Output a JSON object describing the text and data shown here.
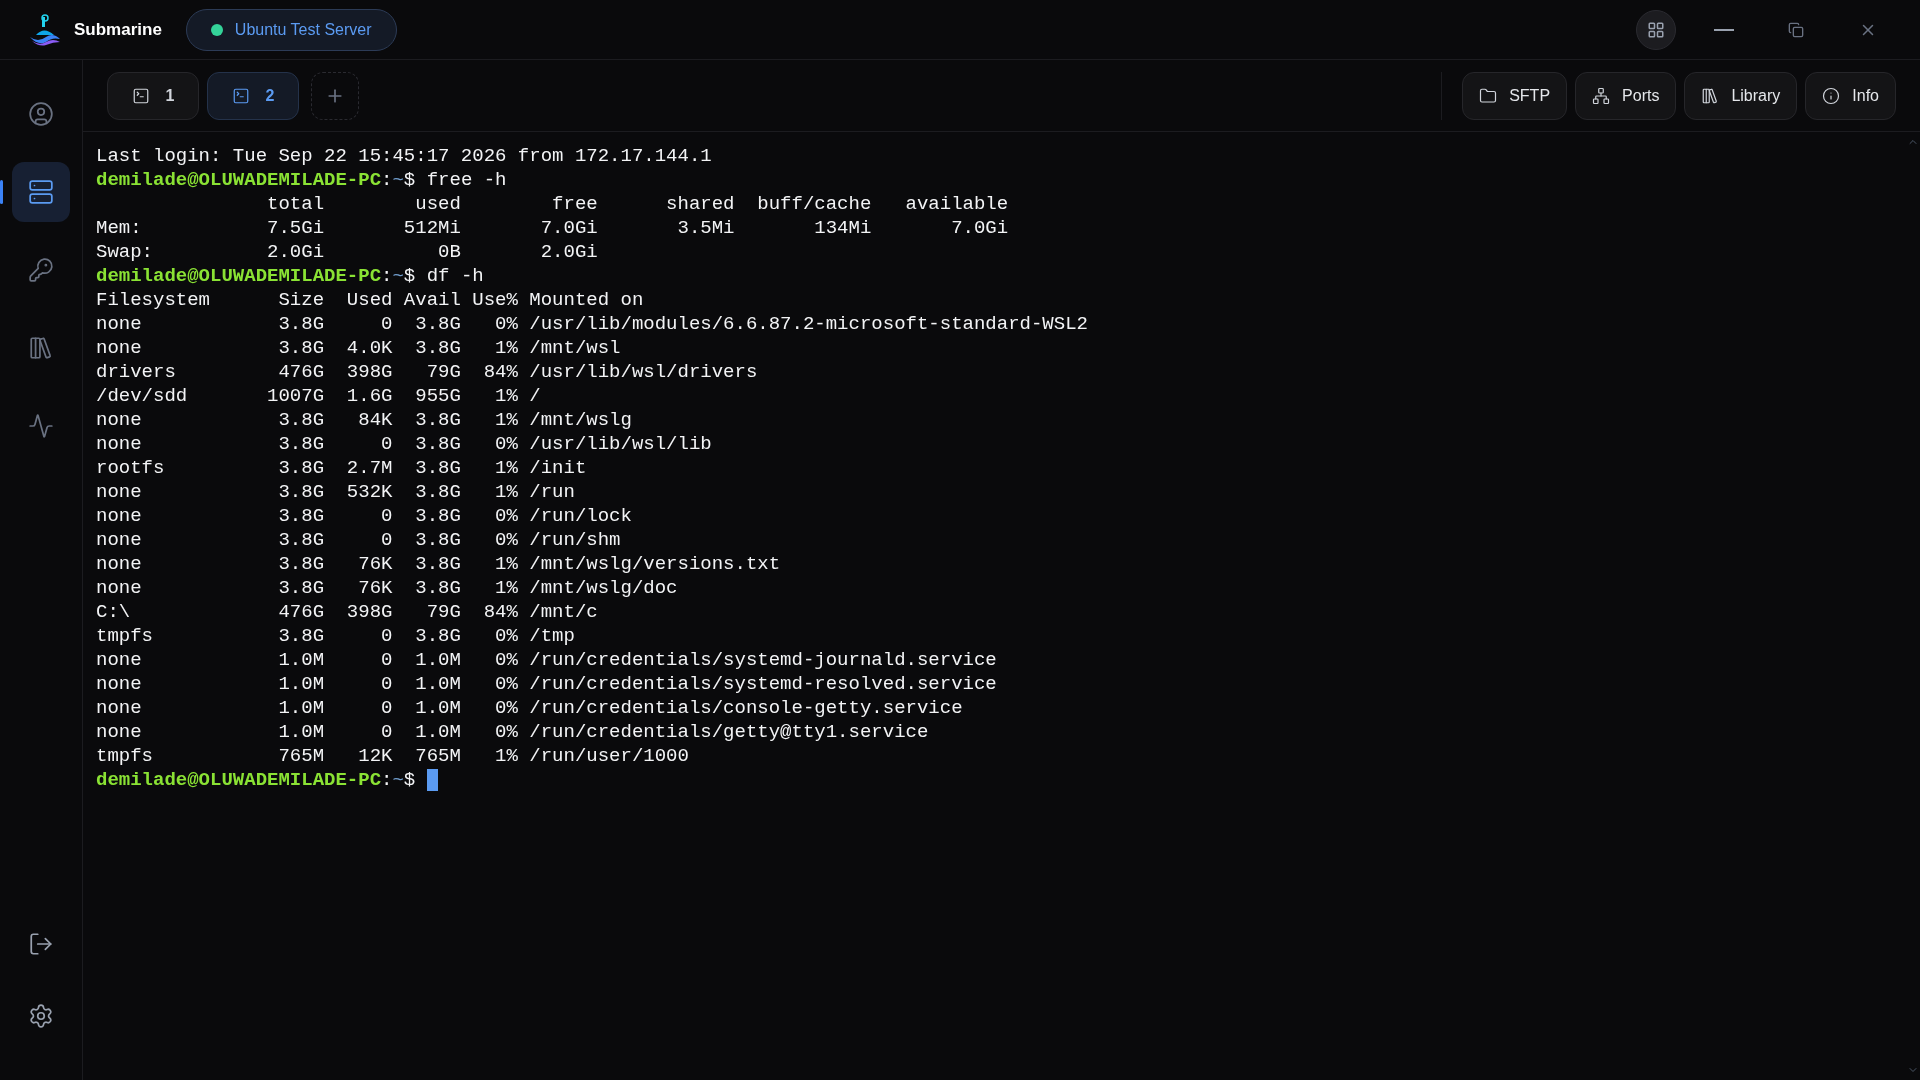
{
  "app": {
    "name": "Submarine"
  },
  "server": {
    "name": "Ubuntu Test Server",
    "color": "#34d399"
  },
  "tabs": [
    {
      "label": "1",
      "selected": false
    },
    {
      "label": "2",
      "selected": true
    }
  ],
  "toolbar": [
    {
      "kind": "sftp",
      "label": "SFTP"
    },
    {
      "kind": "ports",
      "label": "Ports"
    },
    {
      "kind": "library",
      "label": "Library"
    },
    {
      "kind": "info",
      "label": "Info"
    }
  ],
  "sidebar": {
    "items": [
      {
        "kind": "account",
        "selected": false
      },
      {
        "kind": "servers",
        "selected": true
      },
      {
        "kind": "keys",
        "selected": false
      },
      {
        "kind": "library",
        "selected": false
      },
      {
        "kind": "activity",
        "selected": false
      }
    ],
    "bottom": [
      {
        "kind": "logout"
      },
      {
        "kind": "settings"
      }
    ]
  },
  "terminal": {
    "lines": [
      {
        "kind": "output",
        "text": "Last login: Tue Sep 22 15:45:17 2026 from 172.17.144.1"
      },
      {
        "kind": "prompt",
        "user": "demilade@OLUWADEMILADE-PC",
        "separator": ":",
        "path": "~",
        "symbol": "$",
        "command": "free -h",
        "cursor": false
      },
      {
        "kind": "output",
        "text": "               total        used        free      shared  buff/cache   available"
      },
      {
        "kind": "output",
        "text": "Mem:           7.5Gi       512Mi       7.0Gi       3.5Mi       134Mi       7.0Gi"
      },
      {
        "kind": "output",
        "text": "Swap:          2.0Gi          0B       2.0Gi"
      },
      {
        "kind": "prompt",
        "user": "demilade@OLUWADEMILADE-PC",
        "separator": ":",
        "path": "~",
        "symbol": "$",
        "command": "df -h",
        "cursor": false
      },
      {
        "kind": "output",
        "text": "Filesystem      Size  Used Avail Use% Mounted on"
      },
      {
        "kind": "output",
        "text": "none            3.8G     0  3.8G   0% /usr/lib/modules/6.6.87.2-microsoft-standard-WSL2"
      },
      {
        "kind": "output",
        "text": "none            3.8G  4.0K  3.8G   1% /mnt/wsl"
      },
      {
        "kind": "output",
        "text": "drivers         476G  398G   79G  84% /usr/lib/wsl/drivers"
      },
      {
        "kind": "output",
        "text": "/dev/sdd       1007G  1.6G  955G   1% /"
      },
      {
        "kind": "output",
        "text": "none            3.8G   84K  3.8G   1% /mnt/wslg"
      },
      {
        "kind": "output",
        "text": "none            3.8G     0  3.8G   0% /usr/lib/wsl/lib"
      },
      {
        "kind": "output",
        "text": "rootfs          3.8G  2.7M  3.8G   1% /init"
      },
      {
        "kind": "output",
        "text": "none            3.8G  532K  3.8G   1% /run"
      },
      {
        "kind": "output",
        "text": "none            3.8G     0  3.8G   0% /run/lock"
      },
      {
        "kind": "output",
        "text": "none            3.8G     0  3.8G   0% /run/shm"
      },
      {
        "kind": "output",
        "text": "none            3.8G   76K  3.8G   1% /mnt/wslg/versions.txt"
      },
      {
        "kind": "output",
        "text": "none            3.8G   76K  3.8G   1% /mnt/wslg/doc"
      },
      {
        "kind": "output",
        "text": "C:\\             476G  398G   79G  84% /mnt/c"
      },
      {
        "kind": "output",
        "text": "tmpfs           3.8G     0  3.8G   0% /tmp"
      },
      {
        "kind": "output",
        "text": "none            1.0M     0  1.0M   0% /run/credentials/systemd-journald.service"
      },
      {
        "kind": "output",
        "text": "none            1.0M     0  1.0M   0% /run/credentials/systemd-resolved.service"
      },
      {
        "kind": "output",
        "text": "none            1.0M     0  1.0M   0% /run/credentials/console-getty.service"
      },
      {
        "kind": "output",
        "text": "none            1.0M     0  1.0M   0% /run/credentials/getty@tty1.service"
      },
      {
        "kind": "output",
        "text": "tmpfs           765M   12K  765M   1% /run/user/1000"
      },
      {
        "kind": "prompt",
        "user": "demilade@OLUWADEMILADE-PC",
        "separator": ":",
        "path": "~",
        "symbol": "$",
        "cursor": true
      }
    ]
  }
}
